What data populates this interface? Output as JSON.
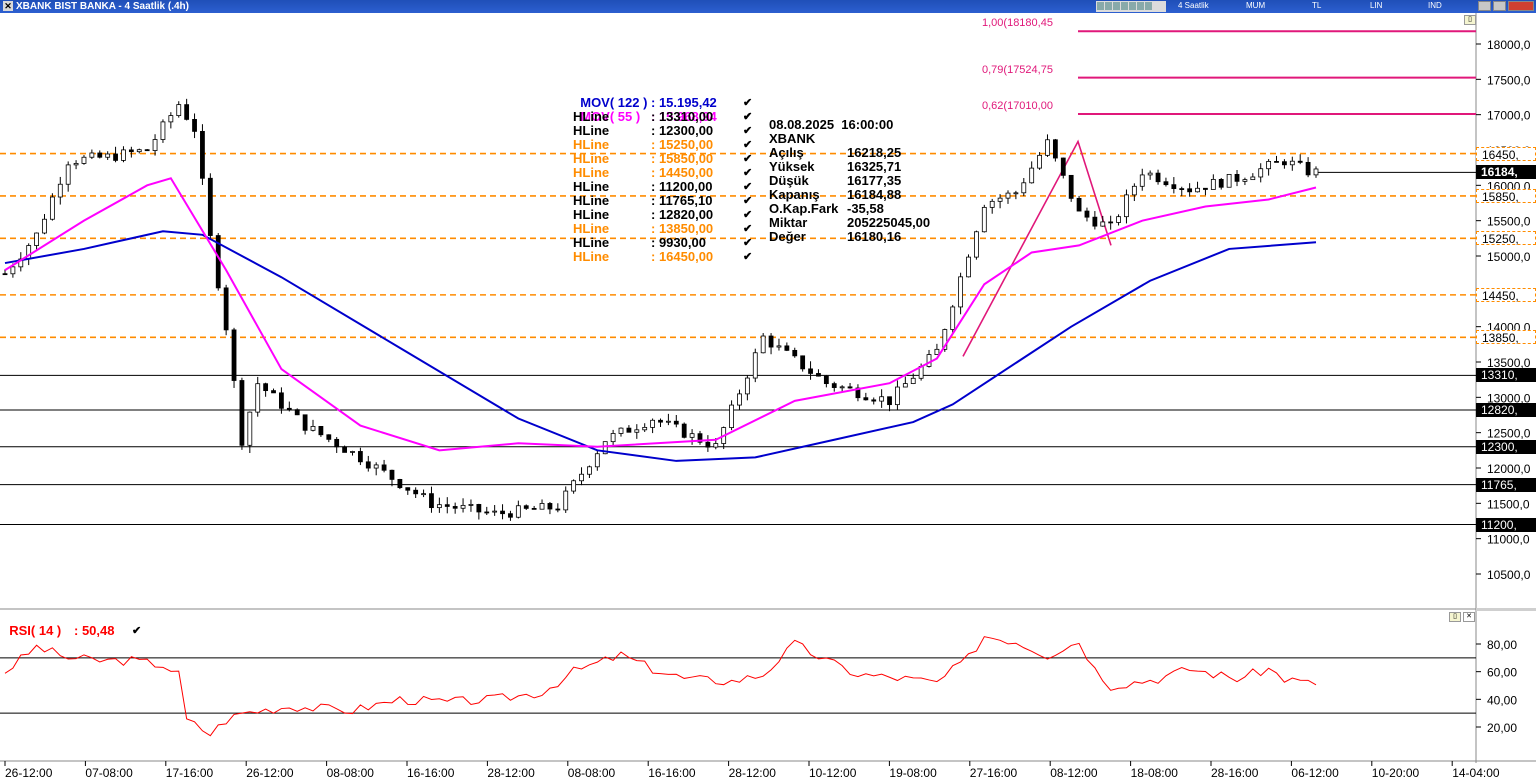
{
  "titlebar": {
    "title": "XBANK BIST BANKA - 4 Saatlik (.4h)",
    "buttons": [
      "4 Saatlik",
      "MUM",
      "TL",
      "LIN",
      "IND"
    ]
  },
  "legend": {
    "mov122_label": "MOV( 122 )",
    "mov122_value": ": 15.195,42",
    "mov55_label": "MOV( 55 )",
    "mov55_value": ": 15.968,94",
    "hlines": [
      {
        "label": "HLine",
        "value": ": 13310,00",
        "color": "#000000"
      },
      {
        "label": "HLine",
        "value": ": 12300,00",
        "color": "#000000"
      },
      {
        "label": "HLine",
        "value": ": 15250,00",
        "color": "#ff8c00"
      },
      {
        "label": "HLine",
        "value": ": 15850,00",
        "color": "#ff8c00"
      },
      {
        "label": "HLine",
        "value": ": 14450,00",
        "color": "#ff8c00"
      },
      {
        "label": "HLine",
        "value": ": 11200,00",
        "color": "#000000"
      },
      {
        "label": "HLine",
        "value": ": 11765,10",
        "color": "#000000"
      },
      {
        "label": "HLine",
        "value": ": 12820,00",
        "color": "#000000"
      },
      {
        "label": "HLine",
        "value": ": 13850,00",
        "color": "#ff8c00"
      },
      {
        "label": "HLine",
        "value": ": 9930,00",
        "color": "#000000"
      },
      {
        "label": "HLine",
        "value": ": 16450,00",
        "color": "#ff8c00"
      }
    ]
  },
  "info": {
    "datetime": "08.08.2025  16:00:00",
    "symbol": "XBANK",
    "rows": [
      {
        "label": "Açılış",
        "value": "16218,25"
      },
      {
        "label": "Yüksek",
        "value": "16325,71"
      },
      {
        "label": "Düşük",
        "value": "16177,35"
      },
      {
        "label": "Kapanış",
        "value": "16184,88"
      },
      {
        "label": "O.Kap.Fark",
        "value": "-35,58"
      },
      {
        "label": "Miktar",
        "value": "205225045,00"
      },
      {
        "label": "Değer",
        "value": "16180,16"
      }
    ]
  },
  "fib": [
    {
      "label": "1,00(18180,45",
      "price": 18180.45
    },
    {
      "label": "0,79(17524,75",
      "price": 17524.75
    },
    {
      "label": "0,62(17010,00",
      "price": 17010.0
    }
  ],
  "price_tags": [
    {
      "label": "16450,",
      "price": 16450,
      "style": "orange"
    },
    {
      "label": "16184,",
      "price": 16184,
      "style": "current"
    },
    {
      "label": "15850,",
      "price": 15850,
      "style": "orange"
    },
    {
      "label": "15250,",
      "price": 15250,
      "style": "orange"
    },
    {
      "label": "14450,",
      "price": 14450,
      "style": "orange"
    },
    {
      "label": "13850,",
      "price": 13850,
      "style": "orange"
    },
    {
      "label": "13310,",
      "price": 13310,
      "style": "black"
    },
    {
      "label": "12820,",
      "price": 12820,
      "style": "black"
    },
    {
      "label": "12300,",
      "price": 12300,
      "style": "black"
    },
    {
      "label": "11765,",
      "price": 11765,
      "style": "black"
    },
    {
      "label": "11200,",
      "price": 11200,
      "style": "black"
    }
  ],
  "rsi": {
    "label": "RSI( 14 )",
    "value": ": 50,48"
  },
  "colors": {
    "mov122": "#0000cc",
    "mov55": "#ff00ff",
    "rsi": "#ff0000",
    "fib": "#e0187a",
    "orange": "#ff8c00"
  },
  "chart_data": {
    "type": "candlestick",
    "price_axis": {
      "ticks": [
        18000,
        17500,
        17000,
        16500,
        16000,
        15500,
        15000,
        14500,
        14000,
        13500,
        13000,
        12500,
        12000,
        11500,
        11000,
        10500
      ],
      "tick_labels": [
        "18000,0",
        "17500,0",
        "17000,0",
        "16500,0",
        "16000,0",
        "15500,0",
        "15000,0",
        "14500,0",
        "14000,0",
        "13500,0",
        "13000,0",
        "12500,0",
        "12000,0",
        "11500,0",
        "11000,0",
        "10500,0"
      ],
      "range": [
        10000,
        18400
      ]
    },
    "time_axis": {
      "labels": [
        "26-12:00",
        "07-08:00",
        "17-16:00",
        "26-12:00",
        "08-08:00",
        "16-16:00",
        "28-12:00",
        "08-08:00",
        "16-16:00",
        "28-12:00",
        "10-12:00",
        "19-08:00",
        "27-16:00",
        "08-12:00",
        "18-08:00",
        "28-16:00",
        "06-12:00",
        "10-20:00",
        "14-04:00"
      ],
      "bar_count": 170
    },
    "close_path": [
      [
        0,
        14750
      ],
      [
        4,
        15300
      ],
      [
        8,
        16350
      ],
      [
        13,
        16400
      ],
      [
        18,
        16500
      ],
      [
        22,
        17150
      ],
      [
        24,
        16800
      ],
      [
        26,
        15250
      ],
      [
        28,
        14000
      ],
      [
        30,
        12400
      ],
      [
        32,
        13200
      ],
      [
        38,
        12600
      ],
      [
        45,
        12150
      ],
      [
        54,
        11500
      ],
      [
        62,
        11350
      ],
      [
        70,
        11450
      ],
      [
        76,
        12400
      ],
      [
        82,
        12700
      ],
      [
        90,
        12300
      ],
      [
        96,
        13850
      ],
      [
        104,
        13200
      ],
      [
        112,
        12950
      ],
      [
        118,
        13650
      ],
      [
        124,
        15750
      ],
      [
        128,
        15900
      ],
      [
        132,
        16600
      ],
      [
        136,
        15600
      ],
      [
        140,
        15400
      ],
      [
        144,
        16200
      ],
      [
        150,
        15950
      ],
      [
        156,
        16100
      ],
      [
        162,
        16350
      ],
      [
        165,
        16200
      ],
      [
        166,
        16184
      ]
    ],
    "series": [
      {
        "name": "MOV( 122 )",
        "points": [
          [
            0,
            14900
          ],
          [
            10,
            15100
          ],
          [
            20,
            15350
          ],
          [
            25,
            15300
          ],
          [
            35,
            14700
          ],
          [
            50,
            13700
          ],
          [
            65,
            12700
          ],
          [
            75,
            12250
          ],
          [
            85,
            12100
          ],
          [
            95,
            12150
          ],
          [
            105,
            12400
          ],
          [
            115,
            12650
          ],
          [
            120,
            12900
          ],
          [
            135,
            14000
          ],
          [
            145,
            14650
          ],
          [
            155,
            15100
          ],
          [
            166,
            15195
          ]
        ]
      },
      {
        "name": "MOV( 55 )",
        "points": [
          [
            0,
            14800
          ],
          [
            10,
            15500
          ],
          [
            18,
            16000
          ],
          [
            21,
            16100
          ],
          [
            28,
            14800
          ],
          [
            35,
            13400
          ],
          [
            45,
            12600
          ],
          [
            55,
            12250
          ],
          [
            65,
            12350
          ],
          [
            75,
            12300
          ],
          [
            90,
            12400
          ],
          [
            100,
            12950
          ],
          [
            112,
            13200
          ],
          [
            118,
            13550
          ],
          [
            124,
            14600
          ],
          [
            130,
            15050
          ],
          [
            136,
            15150
          ],
          [
            144,
            15500
          ],
          [
            152,
            15700
          ],
          [
            160,
            15800
          ],
          [
            166,
            15969
          ]
        ]
      },
      {
        "name": "RSI( 14 )",
        "points": [
          [
            0,
            60
          ],
          [
            4,
            78
          ],
          [
            8,
            70
          ],
          [
            12,
            68
          ],
          [
            16,
            68
          ],
          [
            20,
            65
          ],
          [
            22,
            58
          ],
          [
            23,
            25
          ],
          [
            26,
            15
          ],
          [
            28,
            25
          ],
          [
            30,
            30
          ],
          [
            36,
            35
          ],
          [
            44,
            32
          ],
          [
            50,
            40
          ],
          [
            56,
            38
          ],
          [
            62,
            40
          ],
          [
            68,
            45
          ],
          [
            72,
            60
          ],
          [
            78,
            72
          ],
          [
            82,
            62
          ],
          [
            86,
            55
          ],
          [
            92,
            53
          ],
          [
            96,
            58
          ],
          [
            100,
            80
          ],
          [
            104,
            68
          ],
          [
            108,
            58
          ],
          [
            114,
            55
          ],
          [
            118,
            52
          ],
          [
            122,
            70
          ],
          [
            124,
            86
          ],
          [
            128,
            82
          ],
          [
            132,
            72
          ],
          [
            136,
            82
          ],
          [
            138,
            62
          ],
          [
            140,
            50
          ],
          [
            146,
            55
          ],
          [
            150,
            62
          ],
          [
            156,
            55
          ],
          [
            160,
            62
          ],
          [
            162,
            55
          ],
          [
            166,
            50.48
          ]
        ]
      }
    ],
    "rsi_axis": {
      "ticks": [
        80,
        60,
        40,
        20
      ],
      "tick_labels": [
        "80,00",
        "60,00",
        "40,00",
        "20,00"
      ],
      "range": [
        0,
        100
      ],
      "hlines": [
        70,
        30
      ]
    }
  }
}
